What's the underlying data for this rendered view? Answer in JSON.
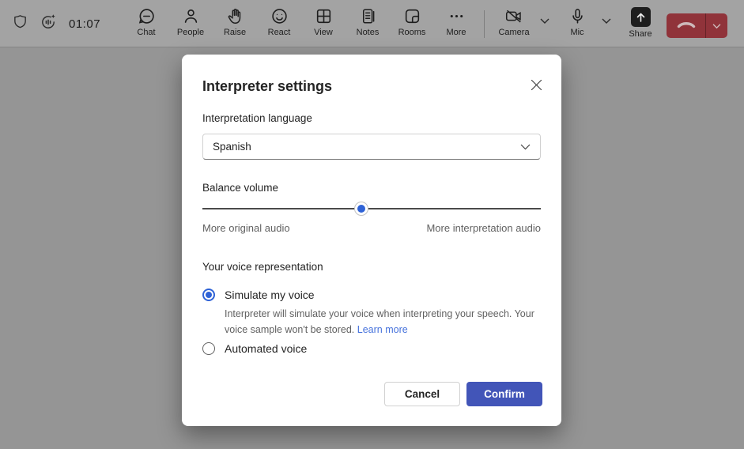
{
  "meeting_bar": {
    "timer": "01:07",
    "items": [
      {
        "label": "Chat",
        "icon": "chat-icon"
      },
      {
        "label": "People",
        "icon": "people-icon"
      },
      {
        "label": "Raise",
        "icon": "raise-hand-icon"
      },
      {
        "label": "React",
        "icon": "react-icon"
      },
      {
        "label": "View",
        "icon": "view-icon"
      },
      {
        "label": "Notes",
        "icon": "notes-icon"
      },
      {
        "label": "Rooms",
        "icon": "rooms-icon"
      },
      {
        "label": "More",
        "icon": "more-icon"
      }
    ],
    "camera_label": "Camera",
    "mic_label": "Mic",
    "share_label": "Share"
  },
  "dialog": {
    "title": "Interpreter settings",
    "language_label": "Interpretation language",
    "language_value": "Spanish",
    "balance_label": "Balance volume",
    "balance_percent": 47,
    "balance_left_label": "More original audio",
    "balance_right_label": "More interpretation audio",
    "voice_section_label": "Your voice representation",
    "voice_options": [
      {
        "label": "Simulate my voice",
        "selected": true,
        "description": "Interpreter will simulate your voice when interpreting your speech. Your voice sample won't be stored.",
        "link_label": "Learn more"
      },
      {
        "label": "Automated voice",
        "selected": false
      }
    ],
    "cancel_label": "Cancel",
    "confirm_label": "Confirm"
  },
  "colors": {
    "primary_button": "#4255b8",
    "control_blue": "#2e62d6",
    "link_blue": "#4672dc",
    "leave_red": "#90333a",
    "backdrop": "#959595"
  }
}
